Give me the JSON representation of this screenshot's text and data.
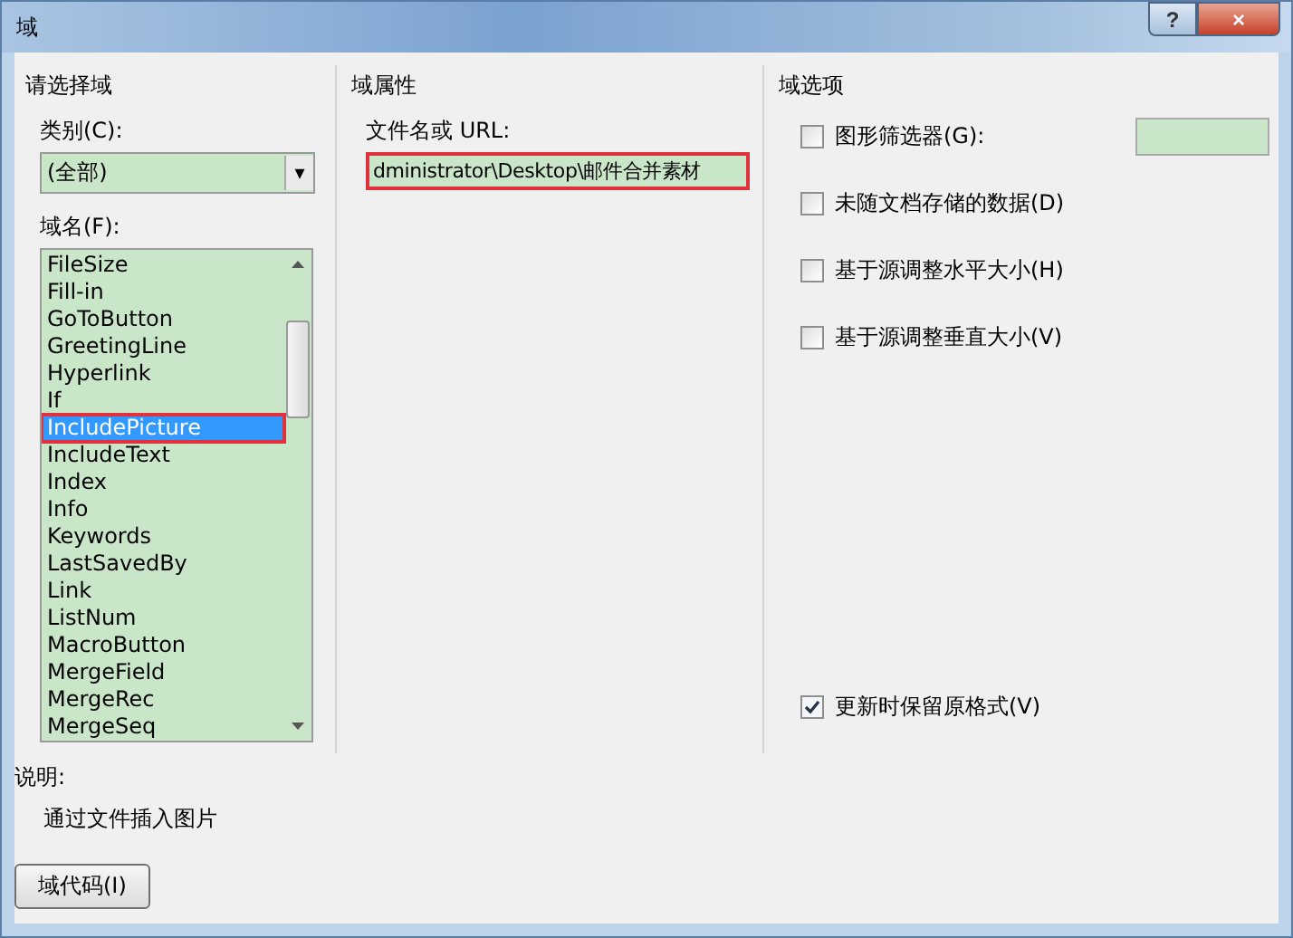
{
  "window": {
    "title": "域",
    "help": "?",
    "close": "×"
  },
  "left": {
    "heading": "请选择域",
    "category_label": "类别(C):",
    "category_value": "(全部)",
    "category_arrow": "▾",
    "name_label": "域名(F):",
    "items": [
      {
        "label": "FileSize",
        "selected": false
      },
      {
        "label": "Fill-in",
        "selected": false
      },
      {
        "label": "GoToButton",
        "selected": false
      },
      {
        "label": "GreetingLine",
        "selected": false
      },
      {
        "label": "Hyperlink",
        "selected": false
      },
      {
        "label": "If",
        "selected": false
      },
      {
        "label": "IncludePicture",
        "selected": true
      },
      {
        "label": "IncludeText",
        "selected": false
      },
      {
        "label": "Index",
        "selected": false
      },
      {
        "label": "Info",
        "selected": false
      },
      {
        "label": "Keywords",
        "selected": false
      },
      {
        "label": "LastSavedBy",
        "selected": false
      },
      {
        "label": "Link",
        "selected": false
      },
      {
        "label": "ListNum",
        "selected": false
      },
      {
        "label": "MacroButton",
        "selected": false
      },
      {
        "label": "MergeField",
        "selected": false
      },
      {
        "label": "MergeRec",
        "selected": false
      },
      {
        "label": "MergeSeq",
        "selected": false
      }
    ]
  },
  "middle": {
    "heading": "域属性",
    "url_label": "文件名或 URL:",
    "url_value": "dministrator\\Desktop\\邮件合并素材"
  },
  "right": {
    "heading": "域选项",
    "options": [
      {
        "kind": "with_field",
        "label": "图形筛选器(G):",
        "checked": false
      },
      {
        "kind": "plain",
        "label": "未随文档存储的数据(D)",
        "checked": false
      },
      {
        "kind": "plain",
        "label": "基于源调整水平大小(H)",
        "checked": false
      },
      {
        "kind": "plain",
        "label": "基于源调整垂直大小(V)",
        "checked": false
      }
    ],
    "preserve": {
      "label": "更新时保留原格式(V)",
      "checked": true
    }
  },
  "description": {
    "label": "说明:",
    "text": "通过文件插入图片"
  },
  "buttons": {
    "field_codes": "域代码(I)"
  }
}
